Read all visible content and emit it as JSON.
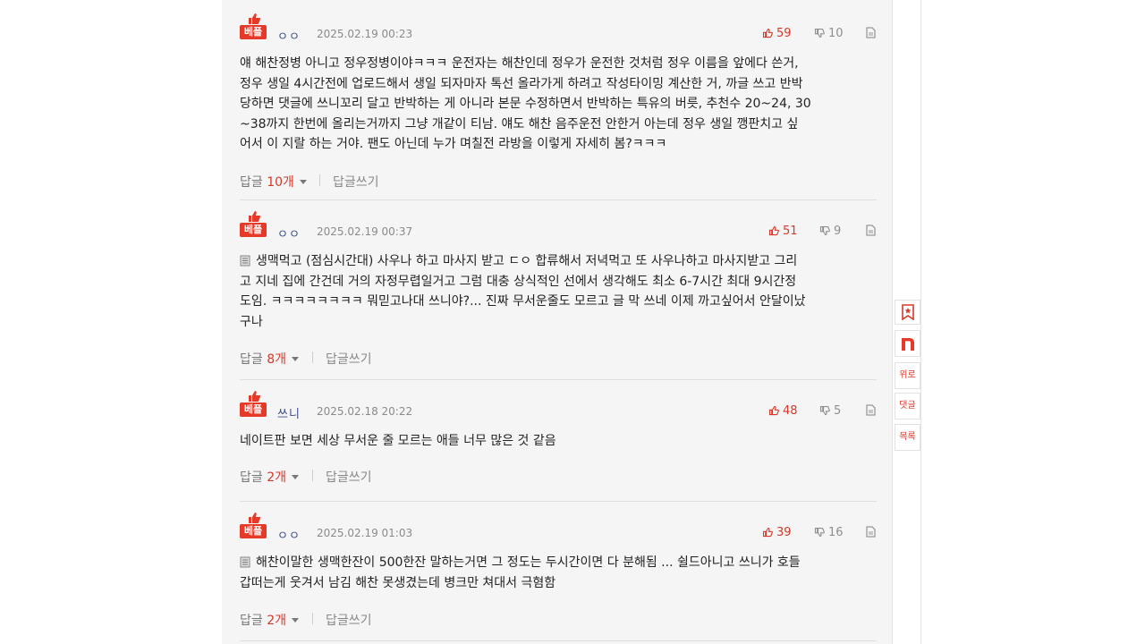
{
  "comments": [
    {
      "badge": "베플",
      "nick": "ㅇㅇ",
      "date": "2025.02.19 00:23",
      "up": "59",
      "down": "10",
      "has_doc_icon": false,
      "lines": [
        "얘 해찬정병 아니고 정우정병이야ㅋㅋㅋ 운전자는 해찬인데 정우가 운전한 것처럼 정우 이름을 앞에다 쓴거,",
        "정우 생일 4시간전에 업로드해서 생일 되자마자 톡선 올라가게 하려고 작성타이밍 계산한 거, 까글 쓰고 반박",
        "당하면 댓글에 쓰니꼬리 달고 반박하는 게 아니라 본문 수정하면서 반박하는 특유의 버릇, 추천수 20~24, 30",
        "~38까지 한번에 올리는거까지 그냥 개같이 티남. 얘도 해찬 음주운전 안한거 아는데 정우 생일 깽판치고 싶",
        "어서 이 지랄 하는 거야. 팬도 아닌데 누가 며칠전 라방을 이렇게 자세히 봄?ㅋㅋㅋ"
      ],
      "reply_label": "답글",
      "reply_count": "10개",
      "write_label": "답글쓰기"
    },
    {
      "badge": "베플",
      "nick": "ㅇㅇ",
      "date": "2025.02.19 00:37",
      "up": "51",
      "down": "9",
      "has_doc_icon": true,
      "lines": [
        "생맥먹고 (점심시간대) 사우나 하고 마사지 받고 ㄷㅇ 합류해서 저녁먹고 또 사우나하고 마사지받고 그리",
        "고 지네 집에 간건데 거의 자정무렵일거고 그럼 대충 상식적인 선에서 생각해도 최소 6-7시간 최대 9시간정",
        "도임. ㅋㅋㅋㅋㅋㅋㅋㅋ 뭐믿고나대 쓰니야?... 진짜 무서운줄도 모르고 글 막 쓰네 이제 까고싶어서 안달이났",
        "구나"
      ],
      "reply_label": "답글",
      "reply_count": "8개",
      "write_label": "답글쓰기"
    },
    {
      "badge": "베플",
      "nick": "쓰니",
      "date": "2025.02.18 20:22",
      "up": "48",
      "down": "5",
      "has_doc_icon": false,
      "lines": [
        "네이트판 보면 세상 무서운 줄 모르는 애들 너무 많은 것 같음"
      ],
      "reply_label": "답글",
      "reply_count": "2개",
      "write_label": "답글쓰기"
    },
    {
      "badge": "베플",
      "nick": "ㅇㅇ",
      "date": "2025.02.19 01:03",
      "up": "39",
      "down": "16",
      "has_doc_icon": true,
      "lines": [
        "해찬이말한 생맥한잔이 500한잔 말하는거면 그 정도는 두시간이면 다 분해됨 ... 쉴드아니고 쓰니가 호들",
        "갑떠는게 웃겨서 남김 해찬 못생겼는데 병크만 쳐대서 극혐함"
      ],
      "reply_label": "답글",
      "reply_count": "2개",
      "write_label": "답글쓰기"
    }
  ],
  "side_buttons": {
    "top": "위로",
    "comments": "댓글",
    "list": "목록"
  },
  "colors": {
    "accent": "#e5392a",
    "panel_bg": "#f5f5f5"
  }
}
